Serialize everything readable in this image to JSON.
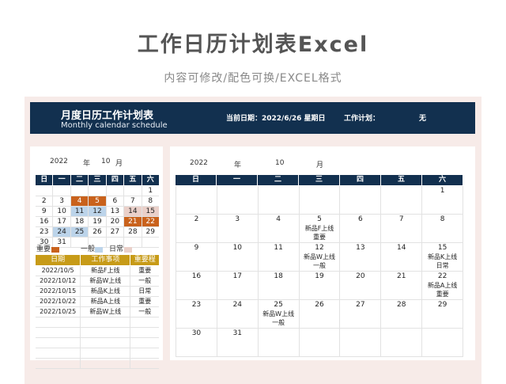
{
  "header": {
    "title": "工作日历计划表Excel",
    "subtitle": "内容可修改/配色可换/EXCEL格式"
  },
  "banner": {
    "title": "月度日历工作计划表",
    "subtitle": "Monthly calendar schedule",
    "current_date": "当前日期：2022/6/26  星期日",
    "plan_label": "工作计划：",
    "plan_value": "无"
  },
  "mini_calendar": {
    "year": "2022",
    "year_unit": "年",
    "month": "10",
    "month_unit": "月",
    "weekdays": [
      "日",
      "一",
      "二",
      "三",
      "四",
      "五",
      "六"
    ],
    "weeks": [
      [
        "",
        "",
        "",
        "",
        "",
        "",
        "1"
      ],
      [
        "2",
        "3",
        "4",
        "5",
        "6",
        "7",
        "8"
      ],
      [
        "9",
        "10",
        "11",
        "12",
        "13",
        "14",
        "15"
      ],
      [
        "16",
        "17",
        "18",
        "19",
        "20",
        "21",
        "22"
      ],
      [
        "23",
        "24",
        "25",
        "26",
        "27",
        "28",
        "29"
      ],
      [
        "30",
        "31",
        "",
        "",
        "",
        "",
        ""
      ]
    ],
    "highlights": {
      "2": "important",
      "3": "important",
      "9": "general",
      "10": "general",
      "13": "daily",
      "14": "daily",
      "19": "important",
      "20": "important",
      "23": "general",
      "24": "general"
    },
    "legend": {
      "important": "重要",
      "general": "一般",
      "daily": "日常"
    },
    "colors": {
      "important": "#c9621c",
      "general": "#bcd4ea",
      "daily": "#ead0c9",
      "header": "#12304f",
      "task_header": "#c79b18"
    }
  },
  "task_table": {
    "headers": [
      "日期",
      "工作事项",
      "重要程度"
    ],
    "rows": [
      [
        "2022/10/5",
        "新品F上线",
        "重要"
      ],
      [
        "2022/10/12",
        "新品W上线",
        "一般"
      ],
      [
        "2022/10/15",
        "新品K上线",
        "日常"
      ],
      [
        "2022/10/22",
        "新品A上线",
        "重要"
      ],
      [
        "2022/10/25",
        "新品W上线",
        "一般"
      ],
      [
        "",
        "",
        ""
      ],
      [
        "",
        "",
        ""
      ],
      [
        "",
        "",
        ""
      ],
      [
        "",
        "",
        ""
      ],
      [
        "",
        "",
        ""
      ]
    ]
  },
  "big_calendar": {
    "year": "2022",
    "year_unit": "年",
    "month": "10",
    "month_unit": "月",
    "weekdays": [
      "日",
      "一",
      "二",
      "三",
      "四",
      "五",
      "六"
    ],
    "weeks": [
      [
        {
          "d": ""
        },
        {
          "d": ""
        },
        {
          "d": ""
        },
        {
          "d": ""
        },
        {
          "d": ""
        },
        {
          "d": ""
        },
        {
          "d": "1"
        }
      ],
      [
        {
          "d": "2"
        },
        {
          "d": "3"
        },
        {
          "d": "4"
        },
        {
          "d": "5",
          "t": "新品F上线",
          "l": "重要"
        },
        {
          "d": "6"
        },
        {
          "d": "7"
        },
        {
          "d": "8"
        }
      ],
      [
        {
          "d": "9"
        },
        {
          "d": "10"
        },
        {
          "d": "11"
        },
        {
          "d": "12",
          "t": "新品W上线",
          "l": "一般"
        },
        {
          "d": "13"
        },
        {
          "d": "14"
        },
        {
          "d": "15",
          "t": "新品K上线",
          "l": "日常"
        }
      ],
      [
        {
          "d": "16"
        },
        {
          "d": "17"
        },
        {
          "d": "18"
        },
        {
          "d": "19"
        },
        {
          "d": "20"
        },
        {
          "d": "21"
        },
        {
          "d": "22",
          "t": "新品A上线",
          "l": "重要"
        }
      ],
      [
        {
          "d": "23"
        },
        {
          "d": "24"
        },
        {
          "d": "25",
          "t": "新品W上线",
          "l": "一般"
        },
        {
          "d": "26"
        },
        {
          "d": "27"
        },
        {
          "d": "28"
        },
        {
          "d": "29"
        }
      ],
      [
        {
          "d": "30"
        },
        {
          "d": "31"
        },
        {
          "d": ""
        },
        {
          "d": ""
        },
        {
          "d": ""
        },
        {
          "d": ""
        },
        {
          "d": ""
        }
      ]
    ]
  }
}
